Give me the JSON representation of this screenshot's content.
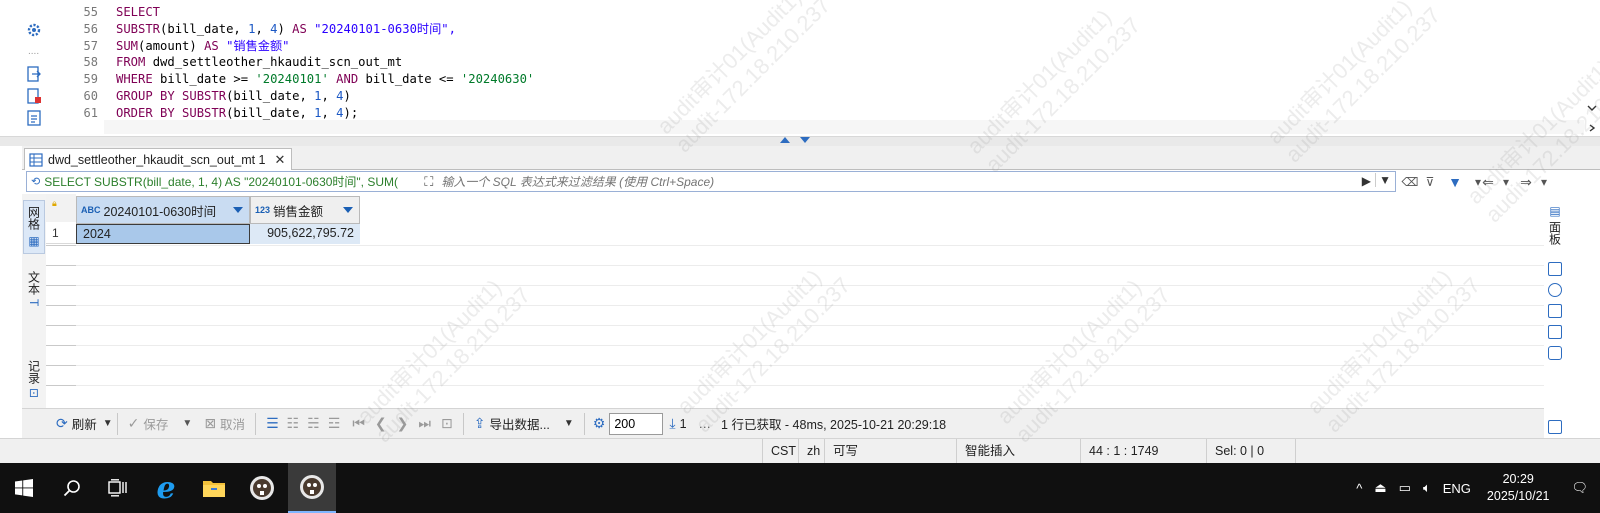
{
  "editor": {
    "lines": [
      {
        "no": "55",
        "tokens": [
          {
            "t": "SELECT",
            "c": "kw"
          }
        ]
      },
      {
        "no": "56",
        "tokens": [
          {
            "t": "SUBSTR",
            "c": "fn"
          },
          {
            "t": "(bill_date, ",
            "c": ""
          },
          {
            "t": "1",
            "c": "num"
          },
          {
            "t": ", ",
            "c": ""
          },
          {
            "t": "4",
            "c": "num"
          },
          {
            "t": ") ",
            "c": ""
          },
          {
            "t": "AS",
            "c": "kw"
          },
          {
            "t": " \"20240101-0630时间\",",
            "c": "str"
          }
        ]
      },
      {
        "no": "57",
        "tokens": [
          {
            "t": "SUM",
            "c": "fn"
          },
          {
            "t": "(amount) ",
            "c": ""
          },
          {
            "t": "AS",
            "c": "kw"
          },
          {
            "t": " \"销售金额\"",
            "c": "str"
          }
        ]
      },
      {
        "no": "58",
        "tokens": [
          {
            "t": "FROM",
            "c": "kw"
          },
          {
            "t": " dwd_settleother_hkaudit_scn_out_mt",
            "c": ""
          }
        ]
      },
      {
        "no": "59",
        "tokens": [
          {
            "t": "WHERE",
            "c": "kw"
          },
          {
            "t": " bill_date >= ",
            "c": ""
          },
          {
            "t": "'20240101'",
            "c": "sstr"
          },
          {
            "t": " ",
            "c": ""
          },
          {
            "t": "AND",
            "c": "kw"
          },
          {
            "t": " bill_date <= ",
            "c": ""
          },
          {
            "t": "'20240630'",
            "c": "sstr"
          }
        ]
      },
      {
        "no": "60",
        "tokens": [
          {
            "t": "GROUP BY",
            "c": "kw"
          },
          {
            "t": " ",
            "c": ""
          },
          {
            "t": "SUBSTR",
            "c": "fn"
          },
          {
            "t": "(bill_date, ",
            "c": ""
          },
          {
            "t": "1",
            "c": "num"
          },
          {
            "t": ", ",
            "c": ""
          },
          {
            "t": "4",
            "c": "num"
          },
          {
            "t": ")",
            "c": ""
          }
        ]
      },
      {
        "no": "61",
        "tokens": [
          {
            "t": "ORDER BY",
            "c": "kw"
          },
          {
            "t": " ",
            "c": ""
          },
          {
            "t": "SUBSTR",
            "c": "fn"
          },
          {
            "t": "(bill_date, ",
            "c": ""
          },
          {
            "t": "1",
            "c": "num"
          },
          {
            "t": ", ",
            "c": ""
          },
          {
            "t": "4",
            "c": "num"
          },
          {
            "t": ");",
            "c": ""
          }
        ]
      }
    ]
  },
  "result_tab": {
    "label": "dwd_settleother_hkaudit_scn_out_mt 1"
  },
  "filter": {
    "query": "SELECT SUBSTR(bill_date, 1, 4) AS \"20240101-0630时间\", SUM(",
    "placeholder": "输入一个 SQL 表达式来过滤结果 (使用 Ctrl+Space)"
  },
  "side_tabs": {
    "grid": "网格",
    "text": "文本",
    "record": "记录",
    "panels": "面板"
  },
  "grid": {
    "columns": [
      {
        "type": "ABC",
        "name": "20240101-0630时间"
      },
      {
        "type": "123",
        "name": "销售金额"
      }
    ],
    "rows": [
      {
        "rownum": "1",
        "cells": [
          "2024",
          "905,622,795.72"
        ]
      }
    ]
  },
  "toolbar": {
    "refresh": "刷新",
    "save": "保存",
    "cancel": "取消",
    "export": "导出数据...",
    "fetch_size": "200",
    "row_count": "1",
    "status": "1 行已获取 - 48ms, 2025-10-21 20:29:18"
  },
  "statusbar": {
    "timezone": "CST",
    "locale": "zh",
    "writable": "可写",
    "insert_mode": "智能插入",
    "position": "44 : 1 : 1749",
    "selection": "Sel: 0 | 0"
  },
  "taskbar": {
    "lang": "ENG",
    "time": "20:29",
    "date": "2025/10/21"
  },
  "watermark": {
    "text": "audit审计01(Audit1)\naudit-172.18.210.237"
  },
  "colors": {
    "accent": "#2d6cc0",
    "selected_cell": "#a9c8ea",
    "taskbar": "#101010"
  }
}
